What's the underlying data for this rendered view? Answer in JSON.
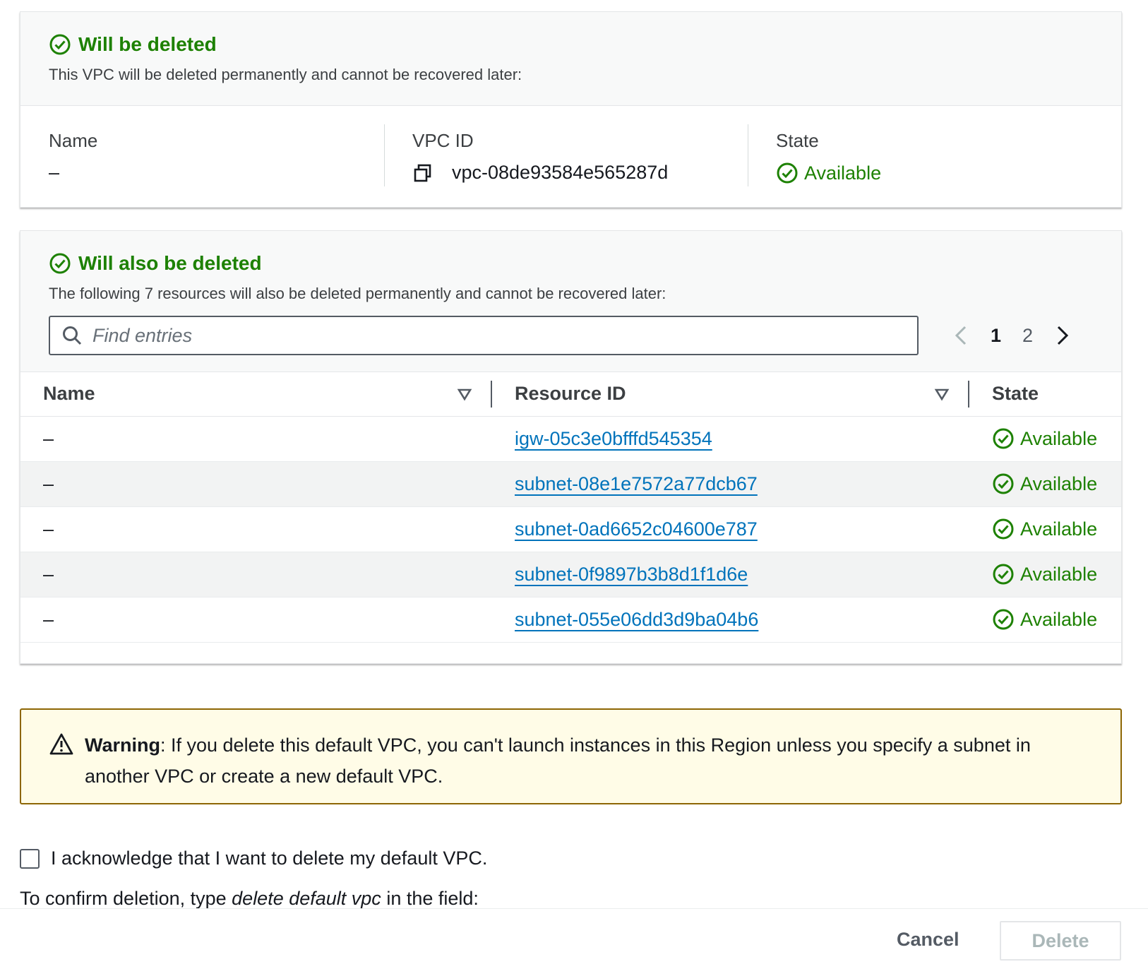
{
  "colors": {
    "success": "#1d8102",
    "link": "#0073bb",
    "warning_border": "#8d6605",
    "warning_bg": "#fffce7"
  },
  "vpc_panel": {
    "title": "Will be deleted",
    "subtitle": "This VPC will be deleted permanently and cannot be recovered later:",
    "name_label": "Name",
    "name_value": "–",
    "vpc_id_label": "VPC ID",
    "vpc_id_value": "vpc-08de93584e565287d",
    "state_label": "State",
    "state_value": "Available",
    "icons": {
      "title": "check-circle-icon",
      "copy": "copy-icon",
      "state": "check-circle-icon"
    }
  },
  "resources_panel": {
    "title": "Will also be deleted",
    "subtitle": "The following 7 resources will also be deleted permanently and cannot be recovered later:",
    "search_placeholder": "Find entries",
    "pagination": {
      "current": "1",
      "next_page": "2"
    },
    "columns": {
      "name": "Name",
      "resource_id": "Resource ID",
      "state": "State"
    },
    "rows": [
      {
        "name": "–",
        "resource_id": "igw-05c3e0bfffd545354",
        "state": "Available"
      },
      {
        "name": "–",
        "resource_id": "subnet-08e1e7572a77dcb67",
        "state": "Available"
      },
      {
        "name": "–",
        "resource_id": "subnet-0ad6652c04600e787",
        "state": "Available"
      },
      {
        "name": "–",
        "resource_id": "subnet-0f9897b3b8d1f1d6e",
        "state": "Available"
      },
      {
        "name": "–",
        "resource_id": "subnet-055e06dd3d9ba04b6",
        "state": "Available"
      }
    ]
  },
  "warning": {
    "label": "Warning",
    "text": ": If you delete this default VPC, you can't launch instances in this Region unless you specify a subnet in another VPC or create a new default VPC."
  },
  "acknowledge": {
    "label": "I acknowledge that I want to delete my default VPC.",
    "checked": false
  },
  "confirm": {
    "prefix": "To confirm deletion, type ",
    "phrase": "delete default vpc",
    "suffix": " in the field:"
  },
  "footer": {
    "cancel_label": "Cancel",
    "delete_label": "Delete"
  }
}
